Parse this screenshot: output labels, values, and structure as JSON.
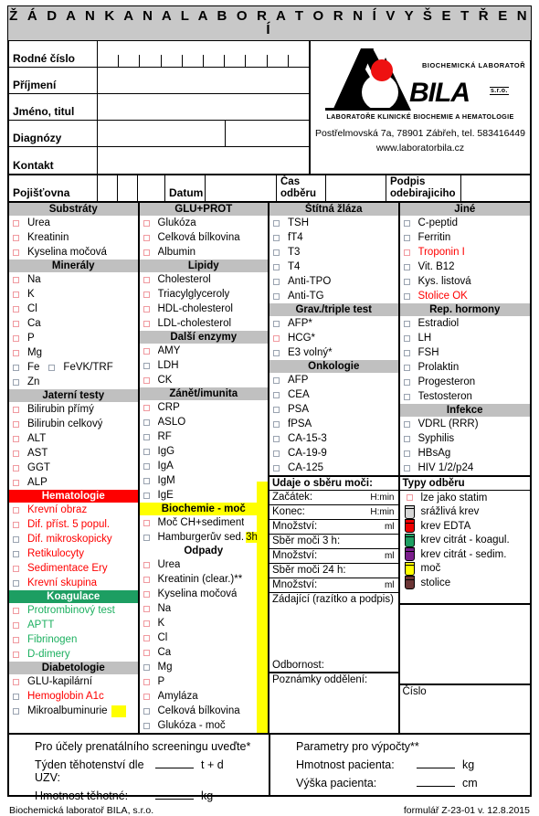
{
  "title": "Ž Á D A N K A   N A   L A B O R A T O R N Í   V Y Š E T Ř E N Í",
  "identity": {
    "rodne_cislo": "Rodné číslo",
    "prijmeni": "Příjmení",
    "jmeno_titul": "Jméno, titul",
    "diagnozy": "Diagnózy",
    "kontakt": "Kontakt"
  },
  "logo": {
    "top_text": "BIOCHEMICKÁ LABORATOŘ",
    "brand": "BILA",
    "sro": "s.r.o.",
    "bottom_text": "LABORATOŘE KLINICKÉ BIOCHEMIE A HEMATOLOGIE",
    "address": "Postřelmovská 7a, 78901 Zábřeh, tel. 583416449",
    "web": "www.laboratorbila.cz"
  },
  "poj_row": {
    "pojistovna": "Pojišťovna",
    "datum": "Datum",
    "cas_odberu": "Čas\nodběru",
    "cas_odberu_l1": "Čas",
    "cas_odberu_l2": "odběru",
    "podpis_l1": "Podpis",
    "podpis_l2": "odebirajiciho"
  },
  "columns": [
    {
      "sections": [
        {
          "header": "Substráty",
          "style": "gray",
          "items": [
            {
              "label": "Urea",
              "cb": "red",
              "text": "black"
            },
            {
              "label": "Kreatinin",
              "cb": "red",
              "text": "black"
            },
            {
              "label": "Kyselina močová",
              "cb": "red",
              "text": "black"
            }
          ]
        },
        {
          "header": "Minerály",
          "style": "gray",
          "items": [
            {
              "label": "Na",
              "sup": "+",
              "cb": "red",
              "text": "black"
            },
            {
              "label": "K",
              "sup": "+",
              "cb": "red",
              "text": "black"
            },
            {
              "label": "Cl",
              "sup": "-",
              "cb": "red",
              "text": "black"
            },
            {
              "label": "Ca",
              "cb": "red",
              "text": "black"
            },
            {
              "label": "P",
              "cb": "red",
              "text": "black"
            },
            {
              "label": "Mg",
              "cb": "red",
              "text": "black"
            },
            {
              "label": "Fe",
              "cb": "gray",
              "text": "black",
              "extra": "FeVK/TRF",
              "extra_cb": "gray"
            },
            {
              "label": "Zn",
              "cb": "gray",
              "text": "black"
            }
          ]
        },
        {
          "header": "Jaterní testy",
          "style": "gray",
          "items": [
            {
              "label": "Bilirubin přímý",
              "cb": "red",
              "text": "black"
            },
            {
              "label": "Bilirubin celkový",
              "cb": "red",
              "text": "black"
            },
            {
              "label": "ALT",
              "cb": "red",
              "text": "black"
            },
            {
              "label": "AST",
              "cb": "red",
              "text": "black"
            },
            {
              "label": "GGT",
              "cb": "red",
              "text": "black"
            },
            {
              "label": "ALP",
              "cb": "red",
              "text": "black"
            }
          ]
        },
        {
          "header": "Hematologie",
          "style": "red",
          "items": [
            {
              "label": "Krevní obraz",
              "cb": "red",
              "text": "red"
            },
            {
              "label": "Dif. příst. 5 popul.",
              "cb": "red",
              "text": "red"
            },
            {
              "label": "Dif. mikroskopicky",
              "cb": "gray",
              "text": "red"
            },
            {
              "label": "Retikulocyty",
              "cb": "gray",
              "text": "red"
            },
            {
              "label": "Sedimentace Ery",
              "cb": "red",
              "text": "red"
            },
            {
              "label": "Krevní skupina",
              "cb": "gray",
              "text": "red"
            }
          ]
        },
        {
          "header": "Koagulace",
          "style": "green",
          "items": [
            {
              "label": "Protrombinový test",
              "cb": "red",
              "text": "green"
            },
            {
              "label": "APTT",
              "cb": "red",
              "text": "green"
            },
            {
              "label": "Fibrinogen",
              "cb": "red",
              "text": "green"
            },
            {
              "label": "D-dimery",
              "cb": "red",
              "text": "green"
            }
          ]
        },
        {
          "header": "Diabetologie",
          "style": "gray",
          "items": [
            {
              "label": "GLU-kapilární",
              "cb": "red",
              "text": "black"
            },
            {
              "label": "Hemoglobin A1c",
              "cb": "gray",
              "text": "red"
            },
            {
              "label": "Mikroalbuminurie",
              "cb": "gray",
              "text": "black",
              "ymark": true
            }
          ]
        }
      ]
    },
    {
      "sections": [
        {
          "header": "GLU+PROT",
          "style": "gray",
          "items": [
            {
              "label": "Glukóza",
              "cb": "red",
              "text": "black"
            },
            {
              "label": "Celková bílkovina",
              "cb": "red",
              "text": "black"
            },
            {
              "label": "Albumin",
              "cb": "red",
              "text": "black"
            }
          ]
        },
        {
          "header": "Lipidy",
          "style": "gray",
          "items": [
            {
              "label": "Cholesterol",
              "cb": "red",
              "text": "black"
            },
            {
              "label": "Triacylglyceroly",
              "cb": "red",
              "text": "black"
            },
            {
              "label": "HDL-cholesterol",
              "cb": "red",
              "text": "black"
            },
            {
              "label": "LDL-cholesterol",
              "cb": "red",
              "text": "black"
            }
          ]
        },
        {
          "header": "Další enzymy",
          "style": "gray",
          "items": [
            {
              "label": "AMY",
              "cb": "red",
              "text": "black"
            },
            {
              "label": "LDH",
              "cb": "gray",
              "text": "black"
            },
            {
              "label": "CK",
              "cb": "red",
              "text": "black"
            }
          ]
        },
        {
          "header": "Zánět/imunita",
          "style": "gray",
          "items": [
            {
              "label": "CRP",
              "cb": "red",
              "text": "black"
            },
            {
              "label": "ASLO",
              "cb": "gray",
              "text": "black"
            },
            {
              "label": "RF",
              "cb": "gray",
              "text": "black"
            },
            {
              "label": "IgG",
              "cb": "gray",
              "text": "black"
            },
            {
              "label": "IgA",
              "cb": "gray",
              "text": "black"
            },
            {
              "label": "IgM",
              "cb": "gray",
              "text": "black"
            },
            {
              "label": "IgE",
              "cb": "gray",
              "text": "black"
            }
          ]
        },
        {
          "header": "Biochemie - moč",
          "style": "yellow",
          "items": [
            {
              "label": "Moč CH+sediment",
              "cb": "red",
              "text": "black"
            },
            {
              "label": "Hamburgerův sed.",
              "cb": "gray",
              "text": "black",
              "suffix": "3h"
            }
          ]
        },
        {
          "header": "Odpady",
          "style": "plain",
          "items": [
            {
              "label": "Urea",
              "cb": "red",
              "text": "black"
            },
            {
              "label": "Kreatinin (clear.)**",
              "cb": "red",
              "text": "black"
            },
            {
              "label": "Kyselina močová",
              "cb": "red",
              "text": "black"
            },
            {
              "label": "Na",
              "sup": "+",
              "cb": "red",
              "text": "black"
            },
            {
              "label": "K",
              "sup": "+",
              "cb": "red",
              "text": "black"
            },
            {
              "label": "Cl",
              "sup": "-",
              "cb": "red",
              "text": "black"
            },
            {
              "label": "Ca",
              "cb": "red",
              "text": "black"
            },
            {
              "label": "Mg",
              "cb": "gray",
              "text": "black"
            },
            {
              "label": "P",
              "cb": "red",
              "text": "black"
            },
            {
              "label": "Amyláza",
              "cb": "red",
              "text": "black"
            },
            {
              "label": "Celková bílkovina",
              "cb": "gray",
              "text": "black"
            },
            {
              "label": "Glukóza - moč",
              "cb": "gray",
              "text": "black"
            }
          ]
        }
      ]
    },
    {
      "sections": [
        {
          "header": "Štítná žláza",
          "style": "gray",
          "items": [
            {
              "label": "TSH",
              "cb": "gray",
              "text": "black"
            },
            {
              "label": "fT4",
              "cb": "gray",
              "text": "black"
            },
            {
              "label": "T3",
              "cb": "gray",
              "text": "black"
            },
            {
              "label": "T4",
              "cb": "gray",
              "text": "black"
            },
            {
              "label": "Anti-TPO",
              "cb": "gray",
              "text": "black"
            },
            {
              "label": "Anti-TG",
              "cb": "gray",
              "text": "black"
            }
          ]
        },
        {
          "header": "Grav./triple test",
          "style": "gray",
          "items": [
            {
              "label": "AFP*",
              "cb": "gray",
              "text": "black"
            },
            {
              "label": "HCG*",
              "cb": "red",
              "text": "black"
            },
            {
              "label": "E3 volný*",
              "cb": "gray",
              "text": "black"
            }
          ]
        },
        {
          "header": "Onkologie",
          "style": "gray",
          "items": [
            {
              "label": "AFP",
              "cb": "gray",
              "text": "black"
            },
            {
              "label": "CEA",
              "cb": "gray",
              "text": "black"
            },
            {
              "label": "PSA",
              "cb": "gray",
              "text": "black"
            },
            {
              "label": "fPSA",
              "cb": "gray",
              "text": "black"
            },
            {
              "label": "CA-15-3",
              "cb": "gray",
              "text": "black"
            },
            {
              "label": "CA-19-9",
              "cb": "gray",
              "text": "black"
            },
            {
              "label": "CA-125",
              "cb": "gray",
              "text": "black"
            }
          ]
        }
      ]
    },
    {
      "sections": [
        {
          "header": "Jiné",
          "style": "gray",
          "items": [
            {
              "label": "C-peptid",
              "cb": "gray",
              "text": "black"
            },
            {
              "label": "Ferritin",
              "cb": "gray",
              "text": "black"
            },
            {
              "label": "Troponin I",
              "cb": "red",
              "text": "red"
            },
            {
              "label": "Vit. B12",
              "cb": "gray",
              "text": "black"
            },
            {
              "label": "Kys. listová",
              "cb": "gray",
              "text": "black"
            },
            {
              "label": "Stolice OK",
              "cb": "gray",
              "text": "red"
            }
          ]
        },
        {
          "header": "Rep. hormony",
          "style": "gray",
          "items": [
            {
              "label": "Estradiol",
              "cb": "gray",
              "text": "black"
            },
            {
              "label": "LH",
              "cb": "gray",
              "text": "black"
            },
            {
              "label": "FSH",
              "cb": "gray",
              "text": "black"
            },
            {
              "label": "Prolaktin",
              "cb": "gray",
              "text": "black"
            },
            {
              "label": "Progesteron",
              "cb": "gray",
              "text": "black"
            },
            {
              "label": "Testosteron",
              "cb": "gray",
              "text": "black"
            }
          ]
        },
        {
          "header": "Infekce",
          "style": "gray",
          "items": [
            {
              "label": "VDRL (RRR)",
              "cb": "gray",
              "text": "black"
            },
            {
              "label": "Syphilis",
              "cb": "gray",
              "text": "black"
            },
            {
              "label": "HBsAg",
              "cb": "gray",
              "text": "black"
            },
            {
              "label": "HIV 1/2/p24",
              "cb": "gray",
              "text": "black"
            }
          ]
        }
      ]
    }
  ],
  "urine_block": {
    "header": "Udaje o sběru moči:",
    "rows": [
      {
        "label": "Začátek:",
        "unit": "H:min"
      },
      {
        "label": "Konec:",
        "unit": "H:min"
      },
      {
        "label": "Množství:",
        "unit": "ml"
      }
    ],
    "collect3": "Sběr moči 3 h:",
    "qty3": "Množství:",
    "qty3_unit": "ml",
    "collect24": "Sběr moči 24 h:",
    "qty24": "Množství:",
    "qty24_unit": "ml",
    "requester": "Zádající (razítko a podpis)",
    "odbornost": "Odbornost:",
    "notes": "Poznámky oddělení:",
    "cislo": "Číslo"
  },
  "tube_types": {
    "header": "Typy odběru",
    "items": [
      {
        "label": "lze jako statim",
        "kind": "checkbox",
        "color": "#ffffff"
      },
      {
        "label": "srážlivá krev",
        "kind": "tube",
        "color": "#d6d6d6"
      },
      {
        "label": "krev EDTA",
        "kind": "tube",
        "color": "#ee0000"
      },
      {
        "label": "krev citrát - koagul.",
        "kind": "tube",
        "color": "#1d9e62"
      },
      {
        "label": "krev citrát - sedim.",
        "kind": "tube",
        "color": "#7b1e8c"
      },
      {
        "label": "moč",
        "kind": "tube",
        "color": "#ffff00"
      },
      {
        "label": "stolice",
        "kind": "tube",
        "color": "#6b3535"
      }
    ]
  },
  "footer_panels": {
    "left": {
      "title": "Pro účely prenatálního screeningu uveďte*",
      "lines": [
        {
          "label": "Týden těhotenství dle UZV:",
          "unit": "t + d"
        },
        {
          "label": "Hmotnost těhotné:",
          "unit": "kg"
        }
      ]
    },
    "right": {
      "title": "Parametry pro výpočty**",
      "lines": [
        {
          "label": "Hmotnost pacienta:",
          "unit": "kg"
        },
        {
          "label": "Výška pacienta:",
          "unit": "cm"
        }
      ]
    }
  },
  "footer_note": {
    "left": "Biochemická laboratoř BILA, s.r.o.",
    "right": "formulář Z-23-01 v. 12.8.2015"
  }
}
